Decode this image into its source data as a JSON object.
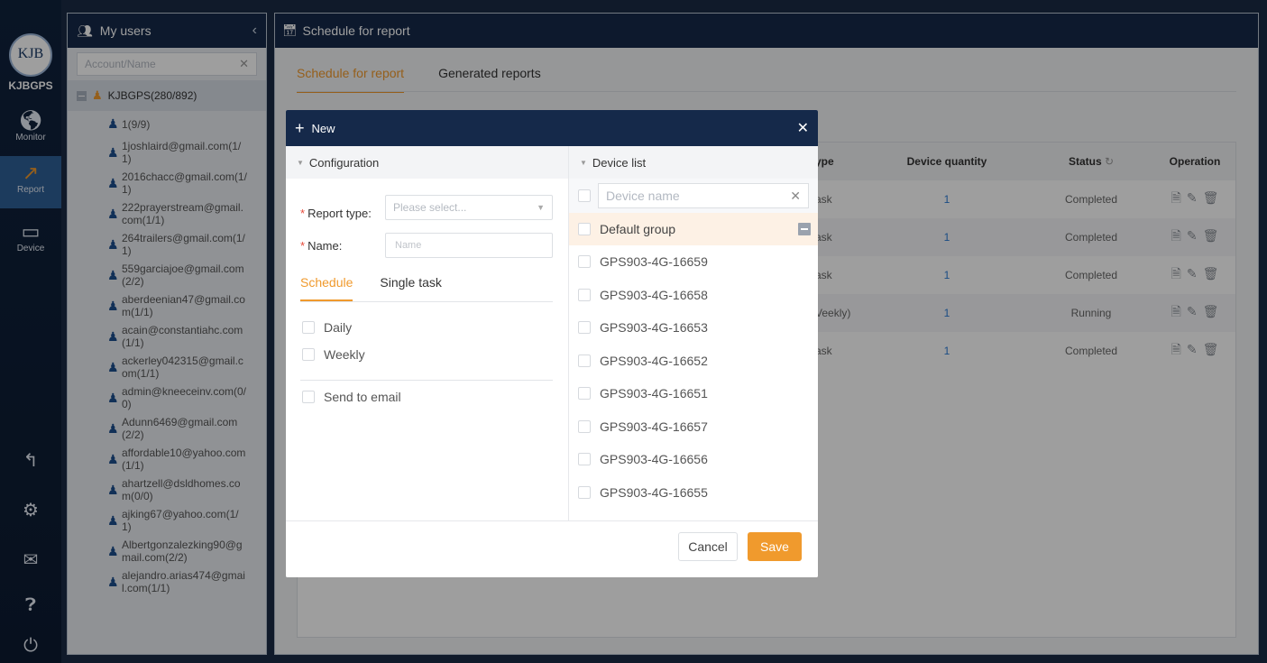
{
  "nav": {
    "brand": "KJBGPS",
    "logo_text": "KJB",
    "items": [
      {
        "label": "Monitor"
      },
      {
        "label": "Report"
      },
      {
        "label": "Device"
      }
    ]
  },
  "users_panel": {
    "title": "My users",
    "search_placeholder": "Account/Name",
    "root": "KJBGPS(280/892)",
    "items": [
      {
        "line1": "1(9/9)",
        "line2": ""
      },
      {
        "line1": "1joshlaird@gmail.com(1/",
        "line2": "1)"
      },
      {
        "line1": "2016chacc@gmail.com(1/",
        "line2": "1)"
      },
      {
        "line1": "222prayerstream@gmail.",
        "line2": "com(1/1)"
      },
      {
        "line1": "264trailers@gmail.com(1/",
        "line2": "1)"
      },
      {
        "line1": "559garciajoe@gmail.com",
        "line2": "(2/2)"
      },
      {
        "line1": "aberdeenian47@gmail.co",
        "line2": "m(1/1)"
      },
      {
        "line1": "acain@constantiahc.com",
        "line2": "(1/1)"
      },
      {
        "line1": "ackerley042315@gmail.c",
        "line2": "om(1/1)"
      },
      {
        "line1": "admin@kneeceinv.com(0/",
        "line2": "0)"
      },
      {
        "line1": "Adunn6469@gmail.com",
        "line2": "(2/2)"
      },
      {
        "line1": "affordable10@yahoo.com",
        "line2": "(1/1)"
      },
      {
        "line1": "ahartzell@dsldhomes.co",
        "line2": "m(0/0)"
      },
      {
        "line1": "ajking67@yahoo.com(1/",
        "line2": "1)"
      },
      {
        "line1": "Albertgonzalezking90@g",
        "line2": "mail.com(2/2)"
      },
      {
        "line1": "alejandro.arias474@gmai",
        "line2": "l.com(1/1)"
      }
    ]
  },
  "main": {
    "title": "Schedule for report",
    "tabs": [
      {
        "label": "Schedule for report"
      },
      {
        "label": "Generated reports"
      }
    ],
    "table": {
      "headers": [
        "ype",
        "Device quantity",
        "Status",
        "Operation"
      ],
      "rows": [
        {
          "type": "ask",
          "qty": "1",
          "status": "Completed"
        },
        {
          "type": "ask",
          "qty": "1",
          "status": "Completed"
        },
        {
          "type": "ask",
          "qty": "1",
          "status": "Completed"
        },
        {
          "type": "Veekly)",
          "qty": "1",
          "status": "Running"
        },
        {
          "type": "ask",
          "qty": "1",
          "status": "Completed"
        }
      ]
    }
  },
  "modal": {
    "title": "New",
    "config": {
      "header": "Configuration",
      "report_type_label": "Report type:",
      "report_type_placeholder": "Please select...",
      "name_label": "Name:",
      "name_placeholder": "Name",
      "tab_schedule": "Schedule",
      "tab_single": "Single task",
      "daily": "Daily",
      "weekly": "Weekly",
      "send_email": "Send to email"
    },
    "devices": {
      "header": "Device list",
      "search_placeholder": "Device name",
      "group": "Default group",
      "items": [
        "GPS903-4G-16659",
        "GPS903-4G-16658",
        "GPS903-4G-16653",
        "GPS903-4G-16652",
        "GPS903-4G-16651",
        "GPS903-4G-16657",
        "GPS903-4G-16656",
        "GPS903-4G-16655"
      ]
    },
    "cancel": "Cancel",
    "save": "Save"
  },
  "colors": {
    "accent": "#f09a2d",
    "header": "#15294a",
    "link": "#2b7bd6"
  }
}
